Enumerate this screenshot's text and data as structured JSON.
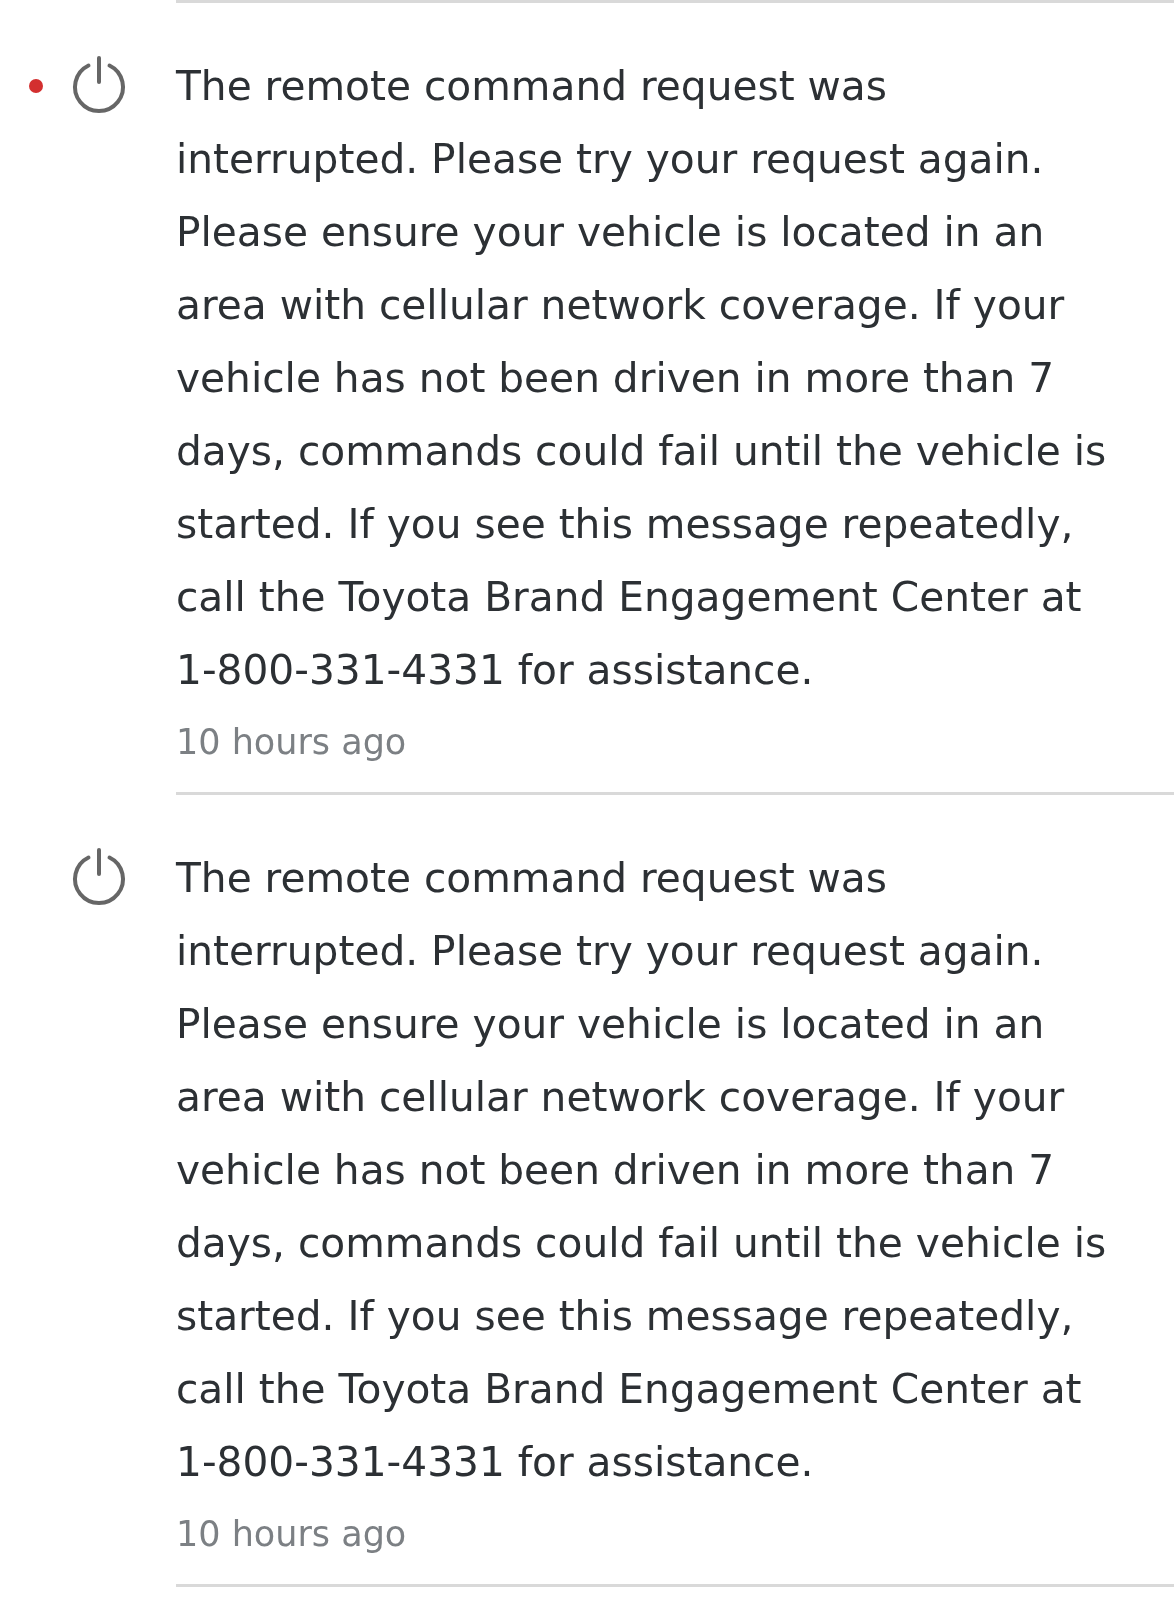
{
  "notifications": [
    {
      "unread": true,
      "message": "The remote command request was interrupted. Please try your request again. Please ensure your vehicle is located in an area with cellular network coverage. If your vehicle has not been driven in more than 7 days, commands could fail until the vehicle is started. If you see this message repeatedly, call the Toyota Brand Engagement Center at 1-800-331-4331 for assistance.",
      "time": "10 hours ago"
    },
    {
      "unread": false,
      "message": "The remote command request was interrupted. Please try your request again. Please ensure your vehicle is located in an area with cellular network coverage. If your vehicle has not been driven in more than 7 days, commands could fail until the vehicle is started. If you see this message repeatedly, call the Toyota Brand Engagement Center at 1-800-331-4331 for assistance.",
      "time": "10 hours ago"
    }
  ]
}
